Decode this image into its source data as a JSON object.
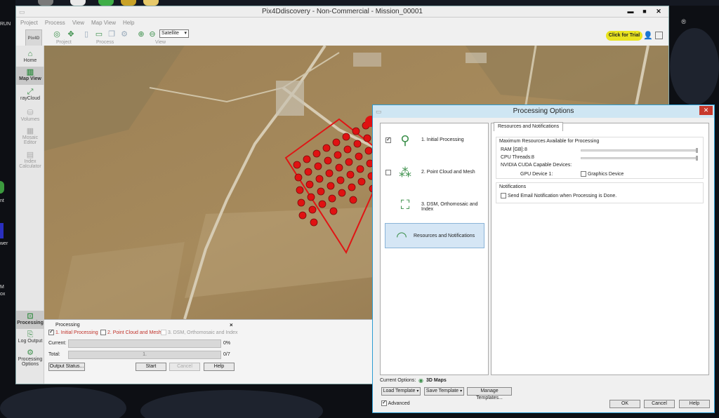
{
  "window": {
    "title": "Pix4Ddiscovery - Non-Commercial - Mission_00001",
    "controls": {
      "minimize": "▬",
      "maximize": "■",
      "close": "✕"
    }
  },
  "menu": [
    "Project",
    "Process",
    "View",
    "Map View",
    "Help"
  ],
  "toolbar": {
    "logo": "Pix4D",
    "groups": [
      "Project",
      "Process",
      "View"
    ],
    "map_type": "Satellite",
    "trial_label": "Click for Trial"
  },
  "desktop": {
    "fragments": [
      "RUN",
      "nt",
      "wer",
      "M",
      "ox"
    ],
    "reg_mark": "®"
  },
  "sidebar": {
    "items": [
      {
        "label": "Home",
        "icon": "home-icon",
        "state": "normal"
      },
      {
        "label": "Map View",
        "icon": "map-icon",
        "state": "active"
      },
      {
        "label": "rayCloud",
        "icon": "raycloud-icon",
        "state": "normal"
      },
      {
        "label": "Volumes",
        "icon": "volumes-icon",
        "state": "disabled"
      },
      {
        "label": "Mosaic Editor",
        "icon": "mosaic-icon",
        "state": "disabled"
      },
      {
        "label": "Index Calculator",
        "icon": "index-icon",
        "state": "disabled"
      },
      {
        "label": "Processing",
        "icon": "processing-icon",
        "state": "active"
      },
      {
        "label": "Log Output",
        "icon": "log-icon",
        "state": "normal"
      },
      {
        "label": "Processing Options",
        "icon": "options-gear-icon",
        "state": "normal"
      }
    ]
  },
  "processing_panel": {
    "header": "Processing",
    "close": "×",
    "steps": [
      {
        "label": "1. Initial Processing",
        "checked": true,
        "color": "#c0322a"
      },
      {
        "label": "2. Point Cloud and Mesh",
        "checked": false,
        "color": "#c0322a"
      },
      {
        "label": "3. DSM, Orthomosaic and Index",
        "checked": false,
        "color": "#999999"
      }
    ],
    "current_label": "Current:",
    "current_pct": "0%",
    "current_value": 0,
    "total_label": "Total:",
    "total_bar_text": "1.",
    "total_count": "0/7",
    "buttons": {
      "output_status": "Output Status...",
      "start": "Start",
      "cancel": "Cancel",
      "help": "Help"
    }
  },
  "dialog": {
    "title": "Processing Options",
    "close": "✕",
    "steps": [
      {
        "label": "1. Initial Processing",
        "checked": true
      },
      {
        "label": "2. Point Cloud and Mesh",
        "checked": false
      },
      {
        "label": "3. DSM, Orthomosaic and Index",
        "checked": null
      },
      {
        "label": "Resources and Notifications",
        "checked": null,
        "selected": true
      }
    ],
    "tab": "Resources and Notifications",
    "resources": {
      "title": "Maximum Resources Available for Processing",
      "ram_label": "RAM [GB]:",
      "ram_value": "8",
      "cpu_label": "CPU Threads:",
      "cpu_value": "8",
      "cuda_label": "NVIDIA CUDA Capable Devices:",
      "gpu_label": "GPU Device 1:",
      "gpu_checkbox": "Graphics Device"
    },
    "notifications": {
      "title": "Notifications",
      "email_label": "Send Email Notification when Processing is Done."
    },
    "footer": {
      "current_options_label": "Current Options:",
      "current_options_value": "3D Maps",
      "load_template": "Load Template",
      "save_template": "Save Template",
      "manage_templates": "Manage Templates...",
      "advanced": "Advanced",
      "ok": "OK",
      "cancel": "Cancel",
      "help": "Help"
    }
  }
}
